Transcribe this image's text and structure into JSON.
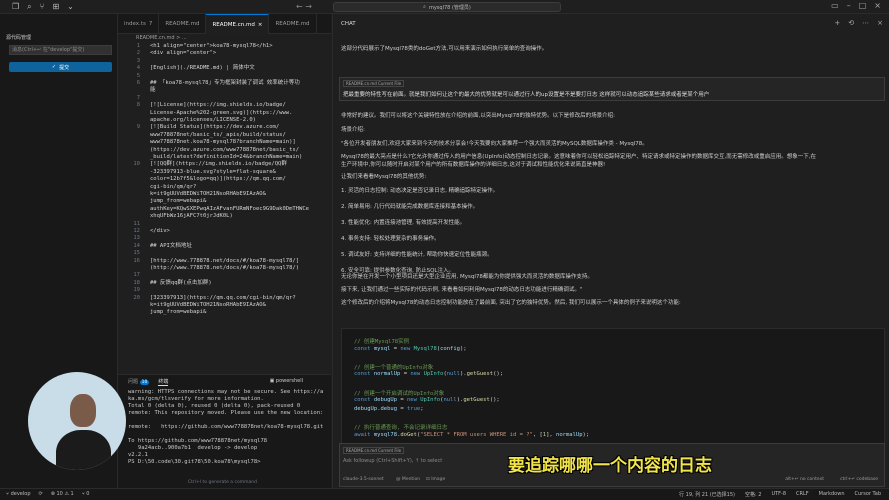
{
  "titlebar": {
    "search": "mysql78 (管理员)",
    "nav_arrows": "←  →"
  },
  "sidebar": {
    "title": "源代码管理",
    "message_placeholder": "消息(Ctrl+↵ 在\"develop\"提交)",
    "commit_label": "提交"
  },
  "tabs": [
    {
      "label": "index.ts",
      "mod": "7"
    },
    {
      "label": "README.md",
      "mod": ""
    },
    {
      "label": "README.cn.md",
      "mod": "×"
    },
    {
      "label": "README.md",
      "mod": ""
    }
  ],
  "breadcrumb": "README.cn.md > ...",
  "editor": {
    "lines": [
      {
        "n": "1",
        "t": "<h1 align=\"center\">koa78-mysql78</h1>"
      },
      {
        "n": "2",
        "t": "<div align=\"center\">"
      },
      {
        "n": "3",
        "t": ""
      },
      {
        "n": "4",
        "t": "[English](./README.md) | 简体中文"
      },
      {
        "n": "5",
        "t": ""
      },
      {
        "n": "6",
        "t": "## 「koa78-mysql78」专为框架封装了调试 效率统计等功"
      },
      {
        "n": "",
        "t": "能"
      },
      {
        "n": "7",
        "t": ""
      },
      {
        "n": "8",
        "t": "[![License](https://img.shields.io/badge/"
      },
      {
        "n": "",
        "t": "License-Apache%202-green.svg)](https://www."
      },
      {
        "n": "",
        "t": "apache.org/licenses/LICENSE-2.0)"
      },
      {
        "n": "9",
        "t": "[![Build Status](https://dev.azure.com/"
      },
      {
        "n": "",
        "t": "www778878net/basic_ts/_apis/build/status/"
      },
      {
        "n": "",
        "t": "www778878net.koa78-mysql78?branchName=main)]"
      },
      {
        "n": "",
        "t": "(https://dev.azure.com/www778878net/basic_ts/"
      },
      {
        "n": "",
        "t": "_build/latest?definitionId=24&branchName=main)"
      },
      {
        "n": "10",
        "t": "[![QQ群](https://img.shields.io/badge/QQ群"
      },
      {
        "n": "",
        "t": "-323397913-blue.svg?style=flat-square&"
      },
      {
        "n": "",
        "t": "color=12b7f5&logo=qq)](https://qm.qq.com/"
      },
      {
        "n": "",
        "t": "cgi-bin/qm/qr?"
      },
      {
        "n": "",
        "t": "k=it9gUUVdBEDWiTOH21NsoRHAbE9IAzAO&"
      },
      {
        "n": "",
        "t": "jump_from=webapi&"
      },
      {
        "n": "",
        "t": "authKey=KQwSXEPwqAIzAFvanFURmNFoec9G9Dak0DmTHWCe"
      },
      {
        "n": "",
        "t": "xhqUFbWz16jAFC7t0jrJdK0L)"
      },
      {
        "n": "11",
        "t": ""
      },
      {
        "n": "12",
        "t": "</div>"
      },
      {
        "n": "13",
        "t": ""
      },
      {
        "n": "14",
        "t": "## API文档地址"
      },
      {
        "n": "15",
        "t": ""
      },
      {
        "n": "16",
        "t": "[http://www.778878.net/docs/#/koa78-mysql78/]"
      },
      {
        "n": "",
        "t": "(http://www.778878.net/docs/#/koa78-mysql78/)"
      },
      {
        "n": "17",
        "t": ""
      },
      {
        "n": "18",
        "t": "## 反馈qq群(点击加群)"
      },
      {
        "n": "19",
        "t": ""
      },
      {
        "n": "20",
        "t": "[323397913](https://qm.qq.com/cgi-bin/qm/qr?"
      },
      {
        "n": "",
        "t": "k=it9gUUVdBEDWiTOH21NsoRHAbE9IAzAO&"
      },
      {
        "n": "",
        "t": "jump_from=webapi&"
      }
    ]
  },
  "panel": {
    "tabs": [
      "问题",
      "终端"
    ],
    "problems_count": "10",
    "shell": "powershell",
    "lines": [
      "warning: HTTPS connections may not be secure. See https://a",
      "ka.ms/gcm/tlsverify for more information.",
      "Total 0 (delta 0), reused 0 (delta 0), pack-reused 0",
      "remote: This repository moved. Please use the new location:",
      "",
      "remote:   https://github.com/www778878net/koa78-mysql78.git",
      "",
      "To https://github.com/www778878net/mysql78",
      "   9a24acb..900a7b1  develop -> develop",
      "v2.2.1",
      "PS D:\\50.code\\30.git78\\50.koa78\\mysql78> "
    ],
    "hint": "Ctrl+I to generate a command"
  },
  "chat": {
    "title": "CHAT",
    "intro": "这部分代码展示了Mysql78类的doGet方法,可以用来演示如何执行简单的查询操作。",
    "context_pill": "README.cn.md Current File",
    "question": "把最重要的特性写在前面。就是我们如何让这个的最大的优势就是可以通过行人的up设置是不是要打日志 这样就可以动态追踪某些请求或者是某个用户",
    "para1": "非常好的建议。我们可以将这个关键特性放在介绍的前面,以突出Mysql78的独特优势。以下是修改后的场景介绍:",
    "section": "场景介绍:",
    "p2": "\"各位开发者朋友们,欢迎大家来到今天的技术分享会!今天我要向大家推荐一个强大而灵活的MySQL数据库操作类 - Mysql78。",
    "p3": "Mysql78的最大亮点是什么?它允许你通过传入的用户信息(UpInfo)动态控制日志记录。这意味着你可以轻松追踪特定用户、特定请求或特定操作的数据库交互,而无需修改或重启应用。想象一下,在",
    "p3b": "生产环境中,你可以随时开启对某个用户的所有数据库操作的详细日志,这对于调试和性能优化来说简直是神器!",
    "p4": "让我们来看看Mysql78的其他优势:",
    "bullets": [
      "1. 灵活的日志控制: 动态决定是否记录日志, 精确追踪特定操作。",
      "2. 简单易用: 几行代码就能完成数据库连接和基本操作。",
      "3. 性能优化: 内置连接池管理, 有效提高开发性能。",
      "4. 事务支持: 轻松处理复杂的事务操作。",
      "5. 调试友好: 支持详细的性能统计, 帮助你快速定位性能瓶颈。",
      "6. 安全可靠: 提供参数化查询, 防止SQL注入。"
    ],
    "p5": "无论你是在开发一个小型项目还是大型企业应用, Mysql78都能为你提供强大而灵活的数据库操作支持。",
    "p6": "接下来, 让我们通过一些实际的代码示例, 来看看如何利用Mysql78的动态日志功能进行精确调试。\"",
    "p7": "这个修改后的介绍将Mysql78的动态日志控制功能放在了最前面, 突出了它的独特优势。然后, 我们可以展示一个具体的例子来说明这个功能:",
    "code": [
      {
        "k": "comment",
        "t": "// 创建Mysql78实例"
      },
      {
        "k": "line1",
        "t": ""
      },
      {
        "k": "blank",
        "t": ""
      },
      {
        "k": "comment",
        "t": "// 创建一个普通的UpInfo对象"
      },
      {
        "k": "line2",
        "t": ""
      },
      {
        "k": "blank",
        "t": ""
      },
      {
        "k": "comment",
        "t": "// 创建一个开启调试的UpInfo对象"
      },
      {
        "k": "line3",
        "t": ""
      },
      {
        "k": "line4",
        "t": ""
      },
      {
        "k": "blank",
        "t": ""
      },
      {
        "k": "comment",
        "t": "// 执行普通查询, 不会记录详细日志"
      },
      {
        "k": "line5",
        "t": ""
      }
    ],
    "input_pill": "README.cn.md Current File",
    "input_placeholder": "Ask followup (Ctrl+Shift+Y), ↑ to select",
    "model": "claude-3.5-sonnet",
    "mention": "@ Mention",
    "image": "⊡ Image",
    "chat_btn": "alt+↵ no context",
    "codebase_btn": "ctrl+↵ codebase"
  },
  "subtitle": "要追踪哪哪一个内容的日志",
  "status": {
    "branch": "develop",
    "sync": "⟳",
    "errors": "⊗ 10 ⚠ 1",
    "ports": "⑂ 0",
    "position": "行 19, 列 21 (已选择15)",
    "spaces": "空格: 2",
    "encoding": "UTF-8",
    "eol": "CRLF",
    "language": "Markdown",
    "tab": "Cursor Tab"
  }
}
